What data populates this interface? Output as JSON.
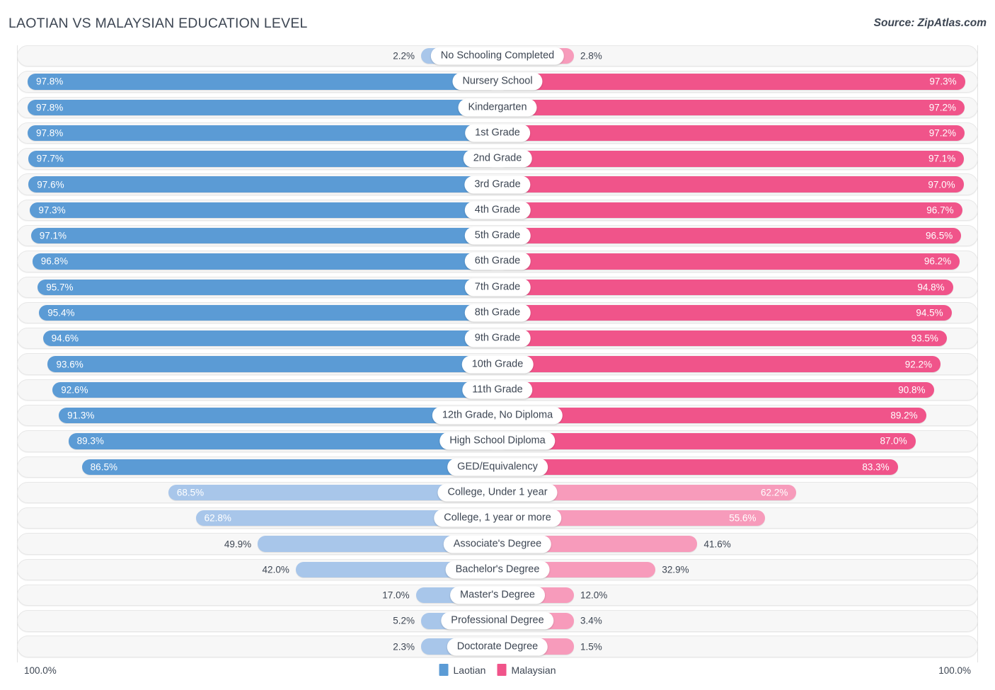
{
  "header": {
    "title": "LAOTIAN VS MALAYSIAN EDUCATION LEVEL",
    "source": "Source: ZipAtlas.com"
  },
  "legend": {
    "items": [
      {
        "label": "Laotian",
        "color": "#5b9bd5"
      },
      {
        "label": "Malaysian",
        "color": "#f0548a"
      }
    ]
  },
  "axis": {
    "left_label": "100.0%",
    "right_label": "100.0%",
    "max": 100.0
  },
  "colors": {
    "blue_strong": "#5b9bd5",
    "blue_light": "#a8c6ea",
    "pink_strong": "#f0548a",
    "pink_light": "#f79bbb",
    "row_background": "#f7f7f7",
    "text": "#3d4653"
  },
  "chart_data": {
    "type": "bar",
    "title": "LAOTIAN VS MALAYSIAN EDUCATION LEVEL",
    "xlabel": "",
    "ylabel": "",
    "orientation": "horizontal-diverging",
    "xlim": [
      0,
      100
    ],
    "grid": false,
    "legend_position": "bottom-center",
    "categories": [
      "No Schooling Completed",
      "Nursery School",
      "Kindergarten",
      "1st Grade",
      "2nd Grade",
      "3rd Grade",
      "4th Grade",
      "5th Grade",
      "6th Grade",
      "7th Grade",
      "8th Grade",
      "9th Grade",
      "10th Grade",
      "11th Grade",
      "12th Grade, No Diploma",
      "High School Diploma",
      "GED/Equivalency",
      "College, Under 1 year",
      "College, 1 year or more",
      "Associate's Degree",
      "Bachelor's Degree",
      "Master's Degree",
      "Professional Degree",
      "Doctorate Degree"
    ],
    "series": [
      {
        "name": "Laotian",
        "side": "left",
        "values": [
          2.2,
          97.8,
          97.8,
          97.8,
          97.7,
          97.6,
          97.3,
          97.1,
          96.8,
          95.7,
          95.4,
          94.6,
          93.6,
          92.6,
          91.3,
          89.3,
          86.5,
          68.5,
          62.8,
          49.9,
          42.0,
          17.0,
          5.2,
          2.3
        ],
        "labels": [
          "2.2%",
          "97.8%",
          "97.8%",
          "97.8%",
          "97.7%",
          "97.6%",
          "97.3%",
          "97.1%",
          "96.8%",
          "95.7%",
          "95.4%",
          "94.6%",
          "93.6%",
          "92.6%",
          "91.3%",
          "89.3%",
          "86.5%",
          "68.5%",
          "62.8%",
          "49.9%",
          "42.0%",
          "17.0%",
          "5.2%",
          "2.3%"
        ]
      },
      {
        "name": "Malaysian",
        "side": "right",
        "values": [
          2.8,
          97.3,
          97.2,
          97.2,
          97.1,
          97.0,
          96.7,
          96.5,
          96.2,
          94.8,
          94.5,
          93.5,
          92.2,
          90.8,
          89.2,
          87.0,
          83.3,
          62.2,
          55.6,
          41.6,
          32.9,
          12.0,
          3.4,
          1.5
        ],
        "labels": [
          "2.8%",
          "97.3%",
          "97.2%",
          "97.2%",
          "97.1%",
          "97.0%",
          "96.7%",
          "96.5%",
          "96.2%",
          "94.8%",
          "94.5%",
          "93.5%",
          "92.2%",
          "90.8%",
          "89.2%",
          "87.0%",
          "83.3%",
          "62.2%",
          "55.6%",
          "41.6%",
          "32.9%",
          "12.0%",
          "3.4%",
          "1.5%"
        ]
      }
    ]
  }
}
